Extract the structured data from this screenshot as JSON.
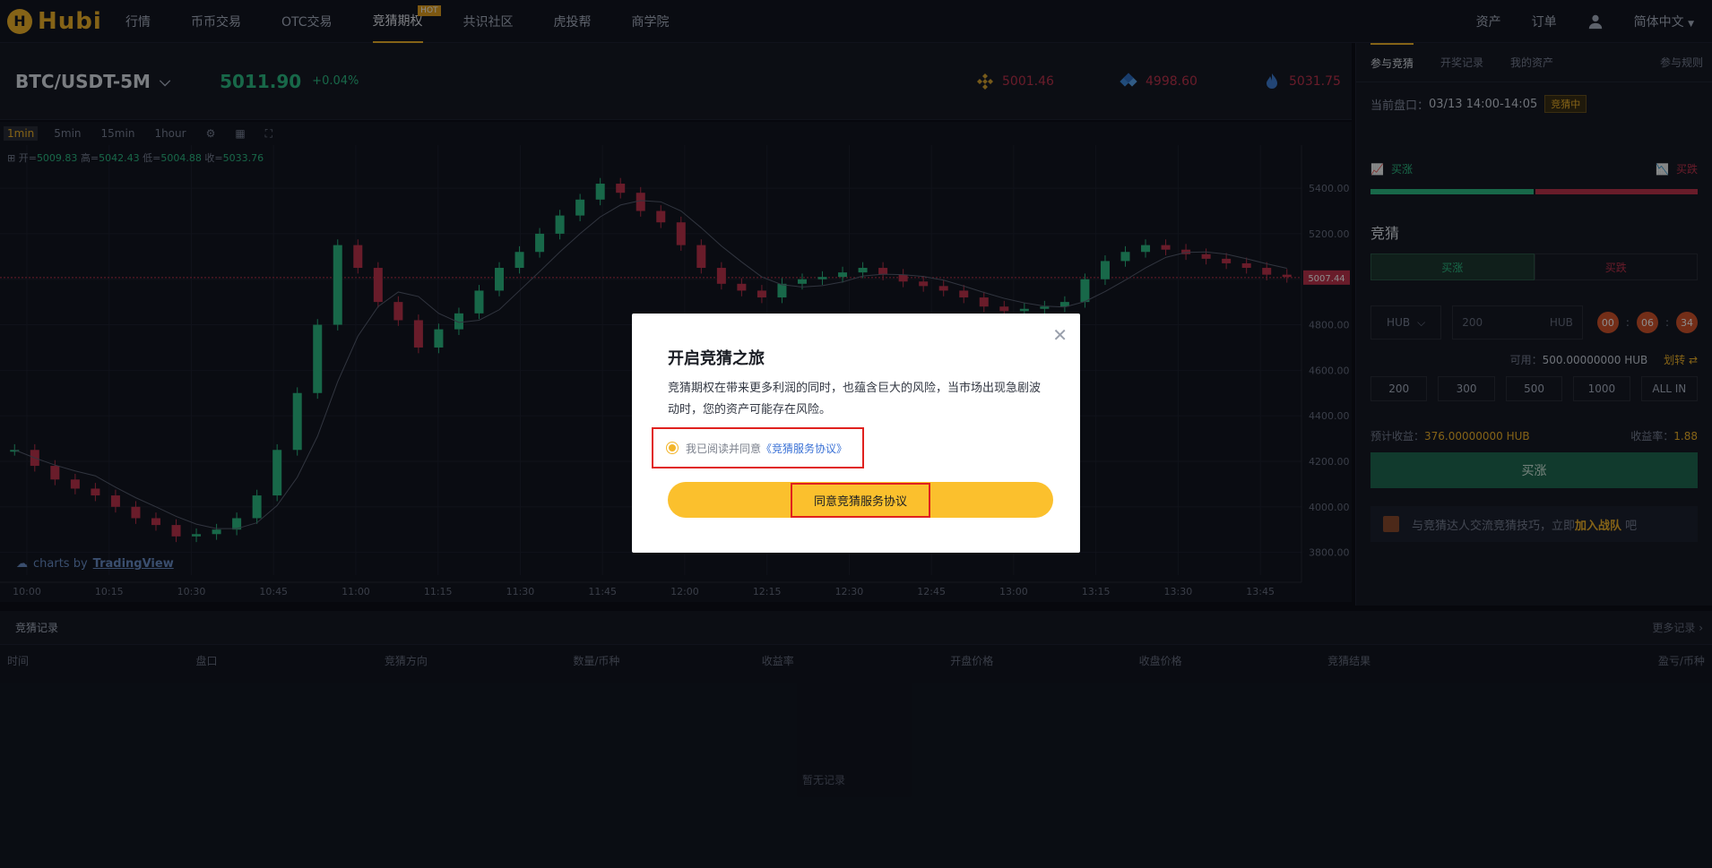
{
  "brand": {
    "name": "Hubi"
  },
  "nav": {
    "items": [
      {
        "label": "行情"
      },
      {
        "label": "币币交易"
      },
      {
        "label": "OTC交易"
      },
      {
        "label": "竞猜期权",
        "badge": "HOT"
      },
      {
        "label": "共识社区"
      },
      {
        "label": "虎投帮"
      },
      {
        "label": "商学院"
      }
    ],
    "right": {
      "assets": "资产",
      "orders": "订单",
      "language": "简体中文"
    }
  },
  "ticker": {
    "pair": "BTC/USDT-5M",
    "price": "5011.90",
    "change": "+0.04%",
    "exchanges": [
      {
        "icon": "binance-icon",
        "value": "5001.46"
      },
      {
        "icon": "okex-icon",
        "value": "4998.60"
      },
      {
        "icon": "huobi-icon",
        "value": "5031.75"
      }
    ]
  },
  "chart_toolbar": {
    "timeframes": [
      "1min",
      "5min",
      "15min",
      "1hour"
    ]
  },
  "chart_data": {
    "type": "line",
    "ohlc": {
      "open_label": "开=",
      "open": "5009.83",
      "high_label": "高=",
      "high": "5042.43",
      "low_label": "低=",
      "low": "5004.88",
      "close_label": "收=",
      "close": "5033.76"
    },
    "x": [
      "10:00",
      "10:15",
      "10:30",
      "10:45",
      "11:00",
      "11:15",
      "11:30",
      "11:45",
      "12:00",
      "12:15",
      "12:30",
      "12:45",
      "13:00",
      "13:15",
      "13:30",
      "13:45"
    ],
    "y_ticks": [
      3800,
      4000,
      4200,
      4400,
      4600,
      4800,
      5000,
      5200,
      5400
    ],
    "ylim": [
      3700,
      5550
    ],
    "current_price": "5007.44",
    "current_value": 5007.44,
    "series": [
      {
        "values": [
          4250,
          4180,
          4120,
          4080,
          4050,
          4000,
          3950,
          3920,
          3870,
          3880,
          3900,
          3950,
          4050,
          4250,
          4500,
          4800,
          5150,
          5050,
          4900,
          4820,
          4700,
          4780,
          4850,
          4950,
          5050,
          5120,
          5200,
          5280,
          5350,
          5420,
          5380,
          5300,
          5250,
          5150,
          5050,
          4980,
          4950,
          4920,
          4980,
          5000,
          5010,
          5030,
          5050,
          5020,
          4990,
          4970,
          4950,
          4920,
          4880,
          4860,
          4870,
          4880,
          4900,
          5000,
          5080,
          5120,
          5150,
          5130,
          5110,
          5090,
          5070,
          5050,
          5020,
          5010
        ]
      }
    ],
    "watermark": {
      "prefix": "charts by",
      "brand": "TradingView"
    }
  },
  "right_panel": {
    "tabs": [
      "参与竞猜",
      "开奖记录",
      "我的资产",
      "参与规则"
    ],
    "session_label": "当前盘口：",
    "session_value": "03/13 14:00-14:05",
    "session_badge": "竞猜中",
    "up_label": "买涨",
    "down_label": "买跌",
    "up_ratio": 0.5,
    "section_title": "竞猜",
    "buy_up_tab": "买涨",
    "buy_down_tab": "买跌",
    "currency": "HUB",
    "amount_placeholder": "200",
    "amount_unit": "HUB",
    "timer": [
      "00",
      "06",
      "34"
    ],
    "available_label": "可用：",
    "available_value": "500.00000000 HUB",
    "transfer": "划转",
    "quick": [
      "200",
      "300",
      "500",
      "1000",
      "ALL IN"
    ],
    "est_label": "预计收益：",
    "est_value": "376.00000000 HUB",
    "rate_label": "收益率：",
    "rate_value": "1.88",
    "buy_button": "买涨",
    "join_text": "与竞猜达人交流竞猜技巧，立即",
    "join_link": "加入战队",
    "join_suffix": "吧"
  },
  "records": {
    "tab": "竞猜记录",
    "more": "更多记录",
    "columns": [
      "时间",
      "盘口",
      "竞猜方向",
      "数量/币种",
      "收益率",
      "开盘价格",
      "收盘价格",
      "竞猜结果",
      "盈亏/币种"
    ],
    "empty": "暂无记录"
  },
  "modal": {
    "title": "开启竞猜之旅",
    "text": "竞猜期权在带来更多利润的同时，也蕴含巨大的风险，当市场出现急剧波动时，您的资产可能存在风险。",
    "agree_prefix": "我已阅读并同意",
    "agree_link": "《竞猜服务协议》",
    "button": "同意竞猜服务协议"
  },
  "colors": {
    "accent": "#f3b52a",
    "up": "#2dbd85",
    "down": "#c0334d",
    "highlight": "#e0211e"
  }
}
